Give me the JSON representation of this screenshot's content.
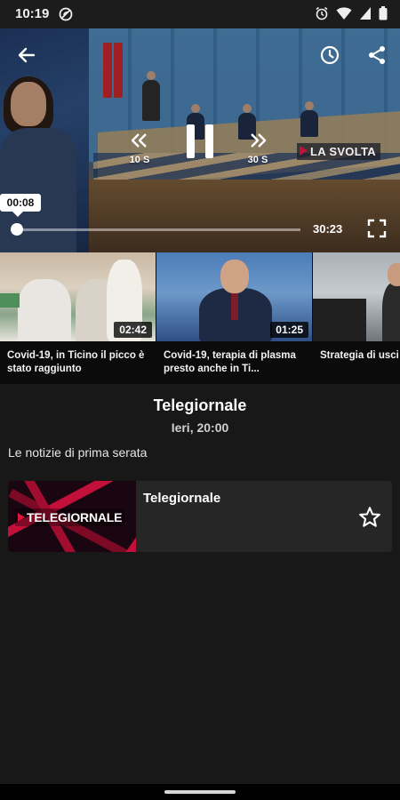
{
  "status_bar": {
    "time": "10:19"
  },
  "player": {
    "rewind_label": "10 S",
    "forward_label": "30 S",
    "channel_tag": "LA SVOLTA",
    "current_time": "00:08",
    "duration": "30:23",
    "progress_fraction": 0.004
  },
  "related": [
    {
      "title": "Covid-19, in Ticino il picco è stato raggiunto",
      "duration": "02:42"
    },
    {
      "title": "Covid-19, terapia di plasma presto anche in Ti...",
      "duration": "01:25"
    },
    {
      "title": "Strategia di usci",
      "duration": ""
    }
  ],
  "show": {
    "title": "Telegiornale",
    "date": "Ieri, 20:00",
    "description": "Le notizie di prima serata"
  },
  "program": {
    "name": "Telegiornale",
    "logo_text": "TELEGIORNALE"
  },
  "colors": {
    "accent": "#c2103a",
    "background": "#181818",
    "card": "#262626"
  }
}
